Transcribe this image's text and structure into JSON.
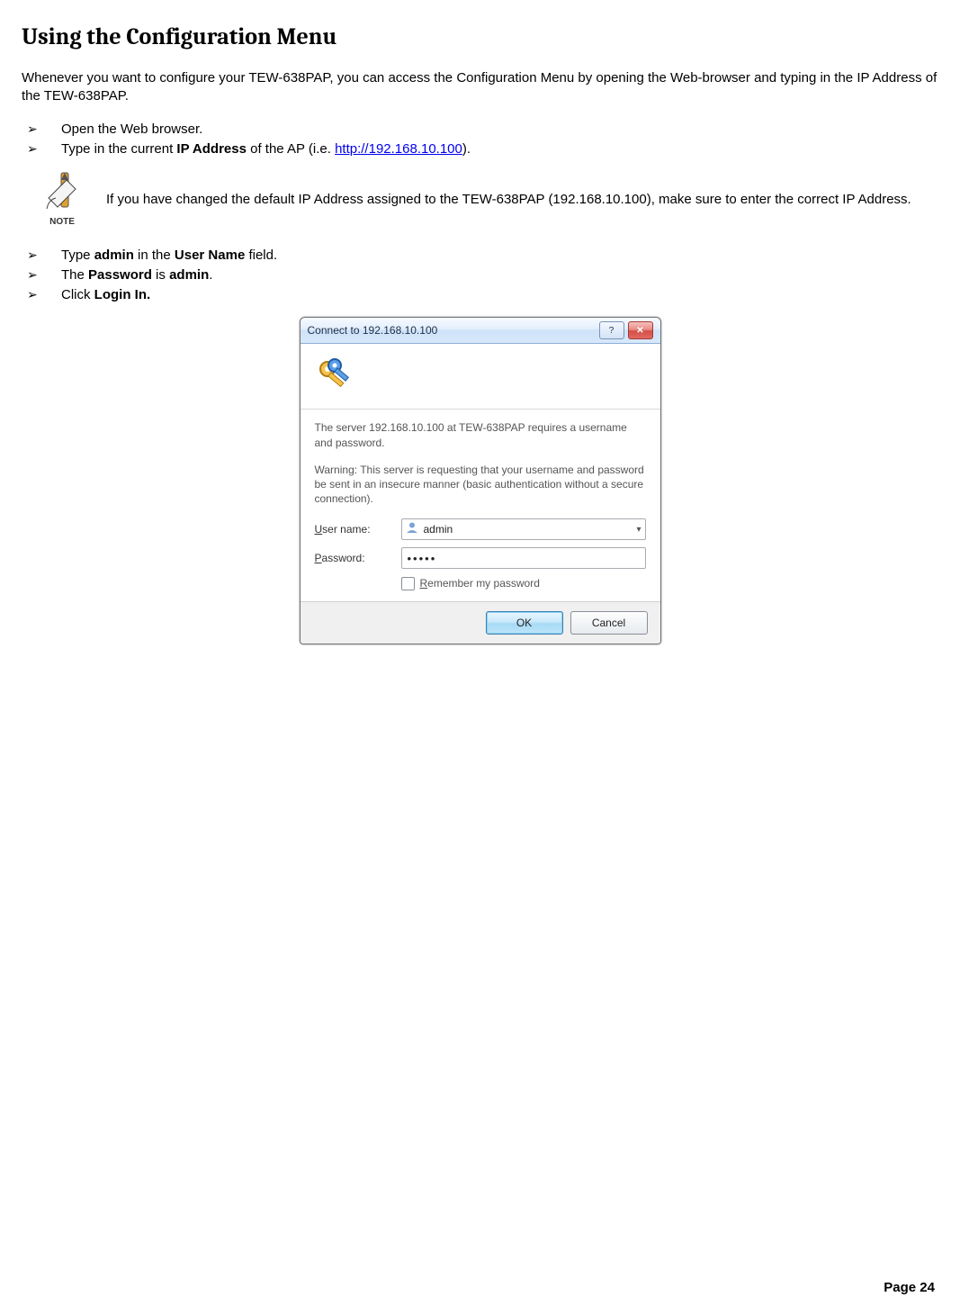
{
  "heading": "Using the Configuration Menu",
  "intro": "Whenever you want to configure your TEW-638PAP, you can access the Configuration Menu by opening the Web-browser and typing in the IP Address of the TEW-638PAP.",
  "bullets1": {
    "b0": "Open the Web browser.",
    "b1_pre": "Type in the current ",
    "b1_bold": "IP Address",
    "b1_mid": " of the AP (i.e. ",
    "b1_link": "http://192.168.10.100",
    "b1_post": ")."
  },
  "note": {
    "label": "NOTE",
    "text": "If you have changed the default IP Address assigned to the TEW-638PAP (192.168.10.100), make sure to enter the correct IP Address."
  },
  "bullets2": {
    "b0_pre": "Type ",
    "b0_bold1": "admin",
    "b0_mid": " in the ",
    "b0_bold2": "User Name",
    "b0_post": " field.",
    "b1_pre": "The ",
    "b1_bold1": "Password",
    "b1_mid": " is ",
    "b1_bold2": "admin",
    "b1_post": ".",
    "b2_pre": "Click ",
    "b2_bold": "Login In."
  },
  "dialog": {
    "title": "Connect to 192.168.10.100",
    "help_label": "?",
    "close_label": "✕",
    "msg1": "The server 192.168.10.100 at TEW-638PAP requires a username and password.",
    "msg2": "Warning: This server is requesting that your username and password be sent in an insecure manner (basic authentication without a secure connection).",
    "username_label_u": "U",
    "username_label_rest": "ser name:",
    "password_label_p": "P",
    "password_label_rest": "assword:",
    "username_value": "admin",
    "password_mask": "•••••",
    "remember_r": "R",
    "remember_rest": "emember my password",
    "ok": "OK",
    "cancel": "Cancel"
  },
  "page_number": "Page 24"
}
